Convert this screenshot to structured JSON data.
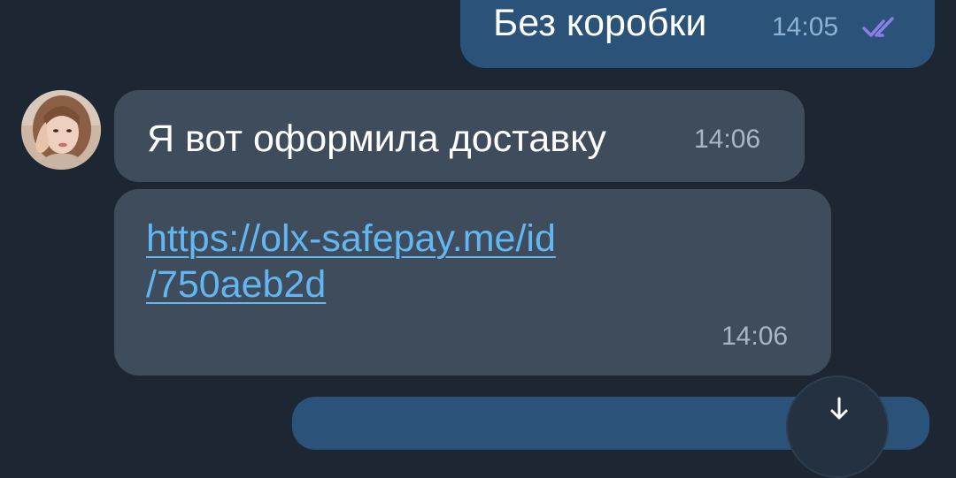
{
  "messages": {
    "outgoing": {
      "text": "Без коробки",
      "time": "14:05",
      "status_icon": "double-check-icon"
    },
    "incoming_1": {
      "text": "Я вот оформила доставку",
      "time": "14:06"
    },
    "incoming_2": {
      "link_line_1": "https://olx-safepay.me/id",
      "link_line_2": "/750aeb2d",
      "time": "14:06"
    }
  },
  "icons": {
    "avatar": "avatar-photo",
    "scroll_down": "arrow-down-icon"
  },
  "colors": {
    "background": "#1c2733",
    "outgoing_bubble": "#2b5278",
    "incoming_bubble": "#3f4c5c",
    "link": "#62b6f2",
    "read_checks": "#8a7fe6"
  }
}
